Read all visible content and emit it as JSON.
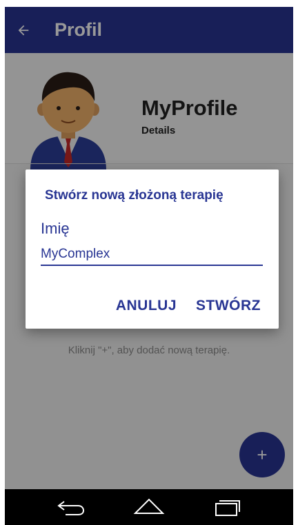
{
  "toolbar": {
    "title": "Profil",
    "back_icon": "arrow-left-icon",
    "color": "#283593"
  },
  "profile": {
    "name": "MyProfile",
    "details": "Details",
    "avatar_icon": "businessman-avatar-icon"
  },
  "empty_hint": "Kliknij \"+\", aby dodać nową terapię.",
  "fab": {
    "label": "+",
    "icon": "plus-icon"
  },
  "dialog": {
    "title": "Stwórz nową złożoną terapię",
    "field_label": "Imię",
    "field_value": "MyComplex",
    "cancel_label": "ANULUJ",
    "create_label": "STWÓRZ"
  },
  "navbar": {
    "back_icon": "nav-back-icon",
    "home_icon": "nav-home-icon",
    "recents_icon": "nav-recents-icon"
  },
  "colors": {
    "primary": "#283593",
    "scrim": "rgba(0,0,0,0.40)"
  }
}
